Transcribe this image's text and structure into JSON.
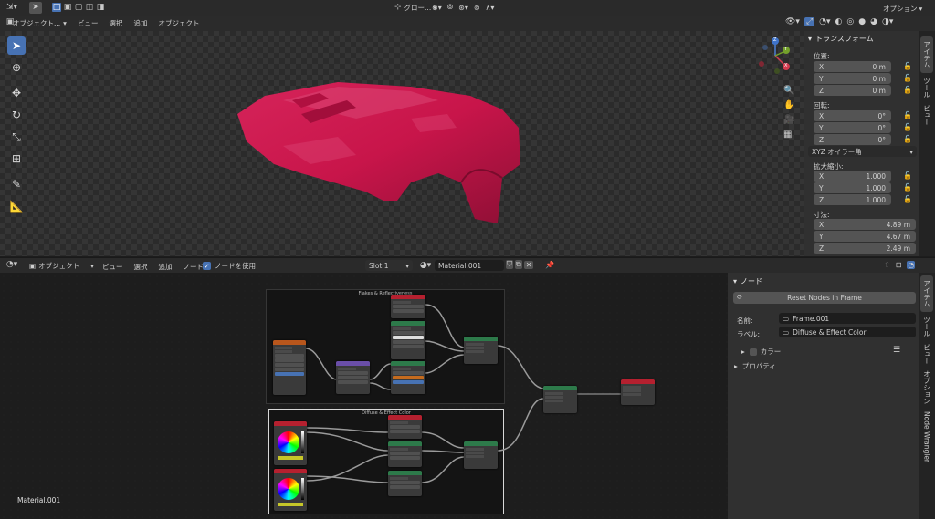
{
  "top_header": {
    "mode_label": "オブジェクト...",
    "menus": [
      "ビュー",
      "選択",
      "追加",
      "オブジェクト"
    ],
    "transform_orientation": "グロー...",
    "options_label": "オプション"
  },
  "n_panel_top": {
    "section_title": "トランスフォーム",
    "location_label": "位置:",
    "location": [
      {
        "axis": "X",
        "value": "0 m"
      },
      {
        "axis": "Y",
        "value": "0 m"
      },
      {
        "axis": "Z",
        "value": "0 m"
      }
    ],
    "rotation_label": "回転:",
    "rotation": [
      {
        "axis": "X",
        "value": "0°"
      },
      {
        "axis": "Y",
        "value": "0°"
      },
      {
        "axis": "Z",
        "value": "0°"
      }
    ],
    "rotation_mode": "XYZ オイラー角",
    "scale_label": "拡大縮小:",
    "scale": [
      {
        "axis": "X",
        "value": "1.000"
      },
      {
        "axis": "Y",
        "value": "1.000"
      },
      {
        "axis": "Z",
        "value": "1.000"
      }
    ],
    "dimensions_label": "寸法:",
    "dimensions": [
      {
        "axis": "X",
        "value": "4.89 m"
      },
      {
        "axis": "Y",
        "value": "4.67 m"
      },
      {
        "axis": "Z",
        "value": "2.49 m"
      }
    ],
    "tabs": [
      "アイテム",
      "ツール",
      "ビュー"
    ]
  },
  "gizmo": {
    "x": "X",
    "y": "Y",
    "z": "Z"
  },
  "node_header": {
    "mode_label": "オブジェクト",
    "menus": [
      "ビュー",
      "選択",
      "追加",
      "ノード"
    ],
    "use_nodes_label": "ノードを使用",
    "slot": "Slot 1",
    "material_name": "Material.001"
  },
  "node_panel": {
    "section_title": "ノード",
    "reset_button": "Reset Nodes in Frame",
    "name_label": "名前:",
    "name_value": "Frame.001",
    "label_label": "ラベル:",
    "label_value": "Diffuse & Effect Color",
    "color_label": "カラー",
    "properties_label": "プロパティ",
    "tabs": [
      "アイテム",
      "ツール",
      "ビュー",
      "オプション",
      "Node Wrangler"
    ]
  },
  "node_editor": {
    "material_label": "Material.001",
    "frame_top_title": "Flakes & Reflectiveness",
    "frame_bottom_title": "Diffuse & Effect Color"
  },
  "colors": {
    "car": "#c8154a",
    "accent_blue": "#4772b3",
    "header_red": "#b5202f",
    "header_green": "#2d7a4a",
    "header_orange": "#b8561c",
    "header_purple": "#6a4ea8",
    "header_teal": "#2a6a5a"
  }
}
